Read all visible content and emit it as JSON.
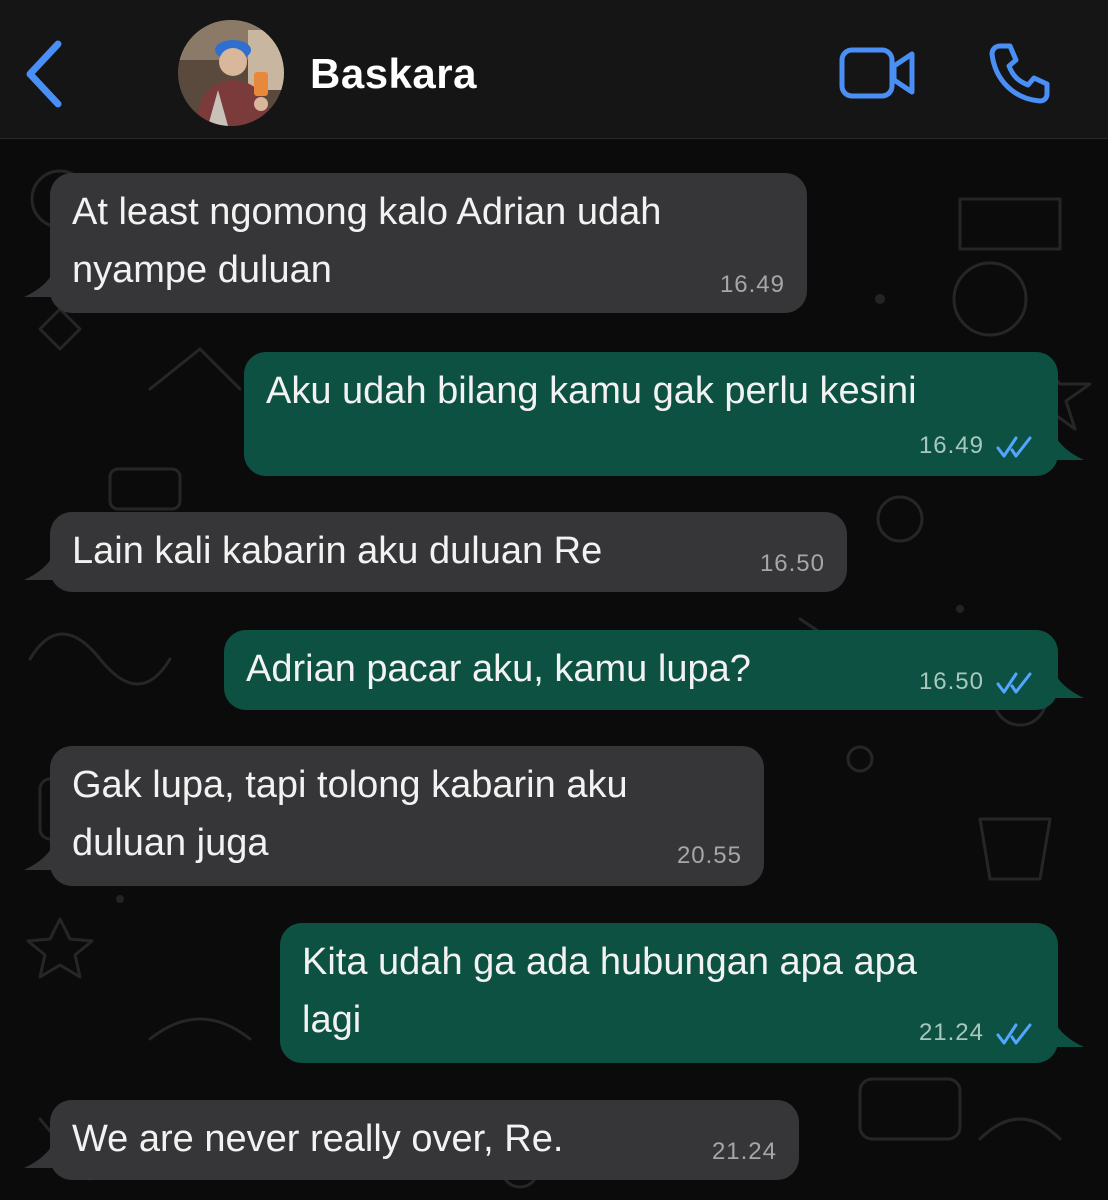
{
  "header": {
    "contact_name": "Baskara",
    "back_icon": "chevron-left-icon",
    "video_icon": "video-camera-icon",
    "call_icon": "phone-icon",
    "accent_color": "#4a8ff5",
    "background_color": "#151515"
  },
  "chat": {
    "incoming_bubble_color": "#363638",
    "outgoing_bubble_color": "#0d5143",
    "read_ticks_color": "#53a6ff",
    "messages": [
      {
        "direction": "incoming",
        "lines": [
          "At least ngomong kalo Adrian udah",
          "nyampe duluan"
        ],
        "time": "16.49"
      },
      {
        "direction": "outgoing",
        "lines": [
          "Aku udah bilang kamu gak perlu kesini"
        ],
        "time": "16.49",
        "status": "read"
      },
      {
        "direction": "incoming",
        "lines": [
          "Lain kali kabarin aku duluan Re"
        ],
        "time": "16.50"
      },
      {
        "direction": "outgoing",
        "lines": [
          "Adrian pacar aku, kamu lupa?"
        ],
        "time": "16.50",
        "status": "read"
      },
      {
        "direction": "incoming",
        "lines": [
          "Gak lupa, tapi tolong kabarin aku",
          "duluan juga"
        ],
        "time": "20.55"
      },
      {
        "direction": "outgoing",
        "lines": [
          "Kita udah ga ada hubungan apa apa",
          "lagi"
        ],
        "time": "21.24",
        "status": "read"
      },
      {
        "direction": "incoming",
        "lines": [
          "We are never really over, Re."
        ],
        "time": "21.24"
      }
    ]
  }
}
